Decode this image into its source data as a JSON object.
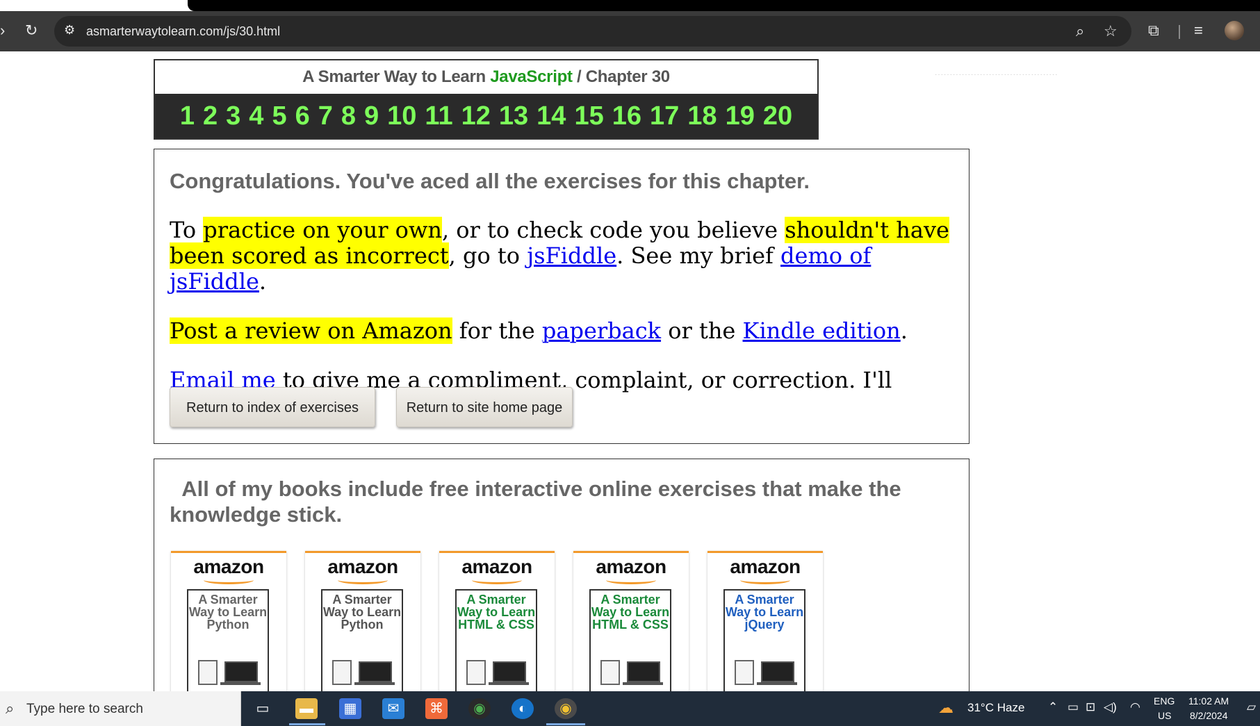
{
  "browser": {
    "url": "asmarterwaytolearn.com/js/30.html"
  },
  "header": {
    "prefix": "A Smarter Way to Learn ",
    "highlight": "JavaScript",
    "suffix": " / Chapter 30",
    "chapters": [
      "1",
      "2",
      "3",
      "4",
      "5",
      "6",
      "7",
      "8",
      "9",
      "10",
      "11",
      "12",
      "13",
      "14",
      "15",
      "16",
      "17",
      "18",
      "19",
      "20"
    ]
  },
  "congrats": {
    "heading": "Congratulations. You've aced all the exercises for this chapter.",
    "p1": {
      "t1": "To ",
      "h1": "practice on your own",
      "t2": ", or to check code you believe ",
      "h2": "shouldn't have been scored as incorrect",
      "t3": ", go to ",
      "link1": "jsFiddle",
      "t4": ". See my brief ",
      "link2": "demo of jsFiddle",
      "t5": "."
    },
    "p2": {
      "h1": "Post a review on Amazon",
      "t1": " for the ",
      "link1": "paperback",
      "t2": " or the ",
      "link2": "Kindle edition",
      "t3": "."
    },
    "p3": {
      "link1": "Email me",
      "t1": " to give me a compliment, complaint, or correction. I'll respond."
    },
    "buttons": {
      "index": "Return to index of exercises",
      "home": "Return to site home page"
    }
  },
  "books": {
    "heading": "  All of my books include free interactive online exercises that make the knowledge stick.",
    "store_label": "amazon",
    "items": [
      {
        "title": "A Smarter Way to Learn Python",
        "color": "#666666"
      },
      {
        "title": "A Smarter Way to Learn Python",
        "color": "#555555"
      },
      {
        "title": "A Smarter Way to Learn HTML & CSS",
        "color": "#1a8a3a"
      },
      {
        "title": "A Smarter Way to Learn HTML & CSS",
        "color": "#1a8a3a"
      },
      {
        "title": "A Smarter Way to Learn jQuery",
        "color": "#1f5fbf"
      }
    ]
  },
  "taskbar": {
    "search_placeholder": "Type here to search",
    "weather": "31°C  Haze",
    "lang1": "ENG",
    "lang2": "US",
    "time": "11:02 AM",
    "date": "8/2/2024"
  }
}
